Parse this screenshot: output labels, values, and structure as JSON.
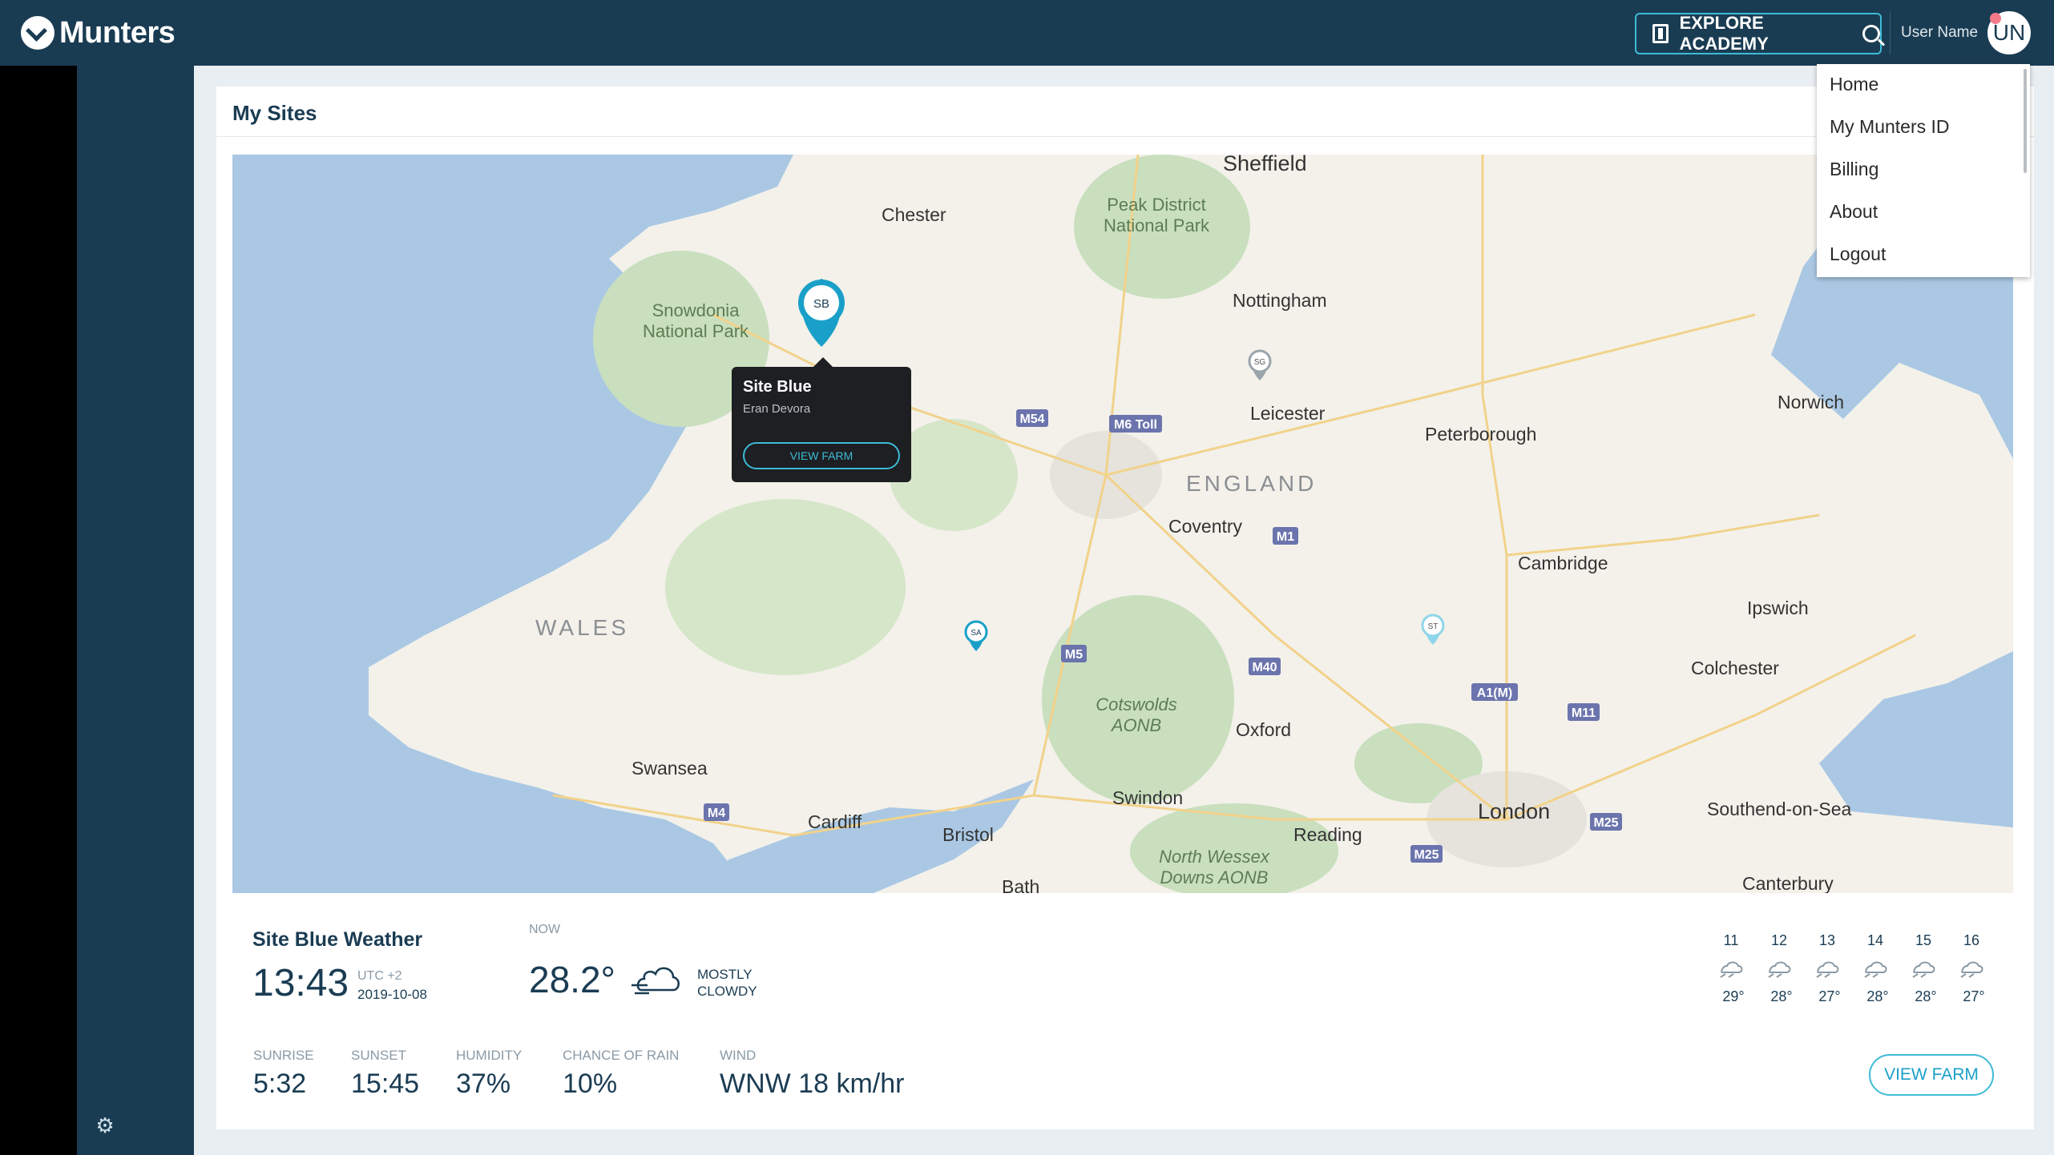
{
  "header": {
    "logo": "Munters",
    "explore_label": "EXPLORE ACADEMY",
    "user_name": "User Name",
    "avatar_initials": "UN"
  },
  "user_menu": {
    "items": [
      {
        "label": "Home"
      },
      {
        "label": "My Munters ID"
      },
      {
        "label": "Billing"
      },
      {
        "label": "About"
      },
      {
        "label": "Logout"
      }
    ]
  },
  "sites": {
    "title": "My Sites"
  },
  "map": {
    "places": [
      "Sheffield",
      "Chester",
      "Nottingham",
      "Leicester",
      "Peterborough",
      "Norwich",
      "Coventry",
      "Cambridge",
      "Ipswich",
      "Colchester",
      "Oxford",
      "Swindon",
      "Reading",
      "London",
      "Southend-on-Sea",
      "Canterbury",
      "Bristol",
      "Cardiff",
      "Swansea",
      "Bath"
    ],
    "regions": [
      "ENGLAND",
      "WALES"
    ],
    "parks": [
      "Peak District",
      "National Park",
      "Snowdonia",
      "National Park",
      "Cotswolds",
      "AONB",
      "North Wessex",
      "Downs AONB"
    ],
    "roads": [
      "M54",
      "M6 Toll",
      "M1",
      "M5",
      "M40",
      "A1(M)",
      "M11",
      "M4",
      "M25",
      "M25"
    ],
    "markers": [
      {
        "id": "SB",
        "color": "#1aa0c8",
        "selected": true
      },
      {
        "id": "SG",
        "color": "#9aa4ab",
        "selected": false
      },
      {
        "id": "SA",
        "color": "#1aa0c8",
        "selected": false
      },
      {
        "id": "ST",
        "color": "#8fd6ea",
        "selected": false
      }
    ],
    "popup": {
      "title": "Site Blue",
      "subtitle": "Eran Devora",
      "button": "VIEW FARM"
    }
  },
  "weather": {
    "title": "Site Blue Weather",
    "time": "13:43",
    "timezone": "UTC +2",
    "date": "2019-10-08",
    "now_label": "NOW",
    "temperature": "28.2°",
    "condition_line1": "MOSTLY",
    "condition_line2": "CLOWDY",
    "stats": [
      {
        "label": "SUNRISE",
        "value": "5:32"
      },
      {
        "label": "SUNSET",
        "value": "15:45"
      },
      {
        "label": "HUMIDITY",
        "value": "37%"
      },
      {
        "label": "CHANCE OF RAIN",
        "value": "10%"
      },
      {
        "label": "WIND",
        "value": "WNW 18 km/hr"
      }
    ],
    "forecast": [
      {
        "day": "11",
        "temp": "29°",
        "icon": "cloud-rain-icon"
      },
      {
        "day": "12",
        "temp": "28°",
        "icon": "cloud-rain-icon"
      },
      {
        "day": "13",
        "temp": "27°",
        "icon": "cloud-rain-icon"
      },
      {
        "day": "14",
        "temp": "28°",
        "icon": "cloud-rain-icon"
      },
      {
        "day": "15",
        "temp": "28°",
        "icon": "cloud-rain-icon"
      },
      {
        "day": "16",
        "temp": "27°",
        "icon": "cloud-rain-icon"
      }
    ],
    "view_farm": "VIEW FARM"
  },
  "colors": {
    "header": "#1a3c53",
    "accent": "#3dbbd6",
    "map_water": "#aac8e4",
    "map_land": "#f3f1ea",
    "map_park": "#c9dfbe"
  }
}
